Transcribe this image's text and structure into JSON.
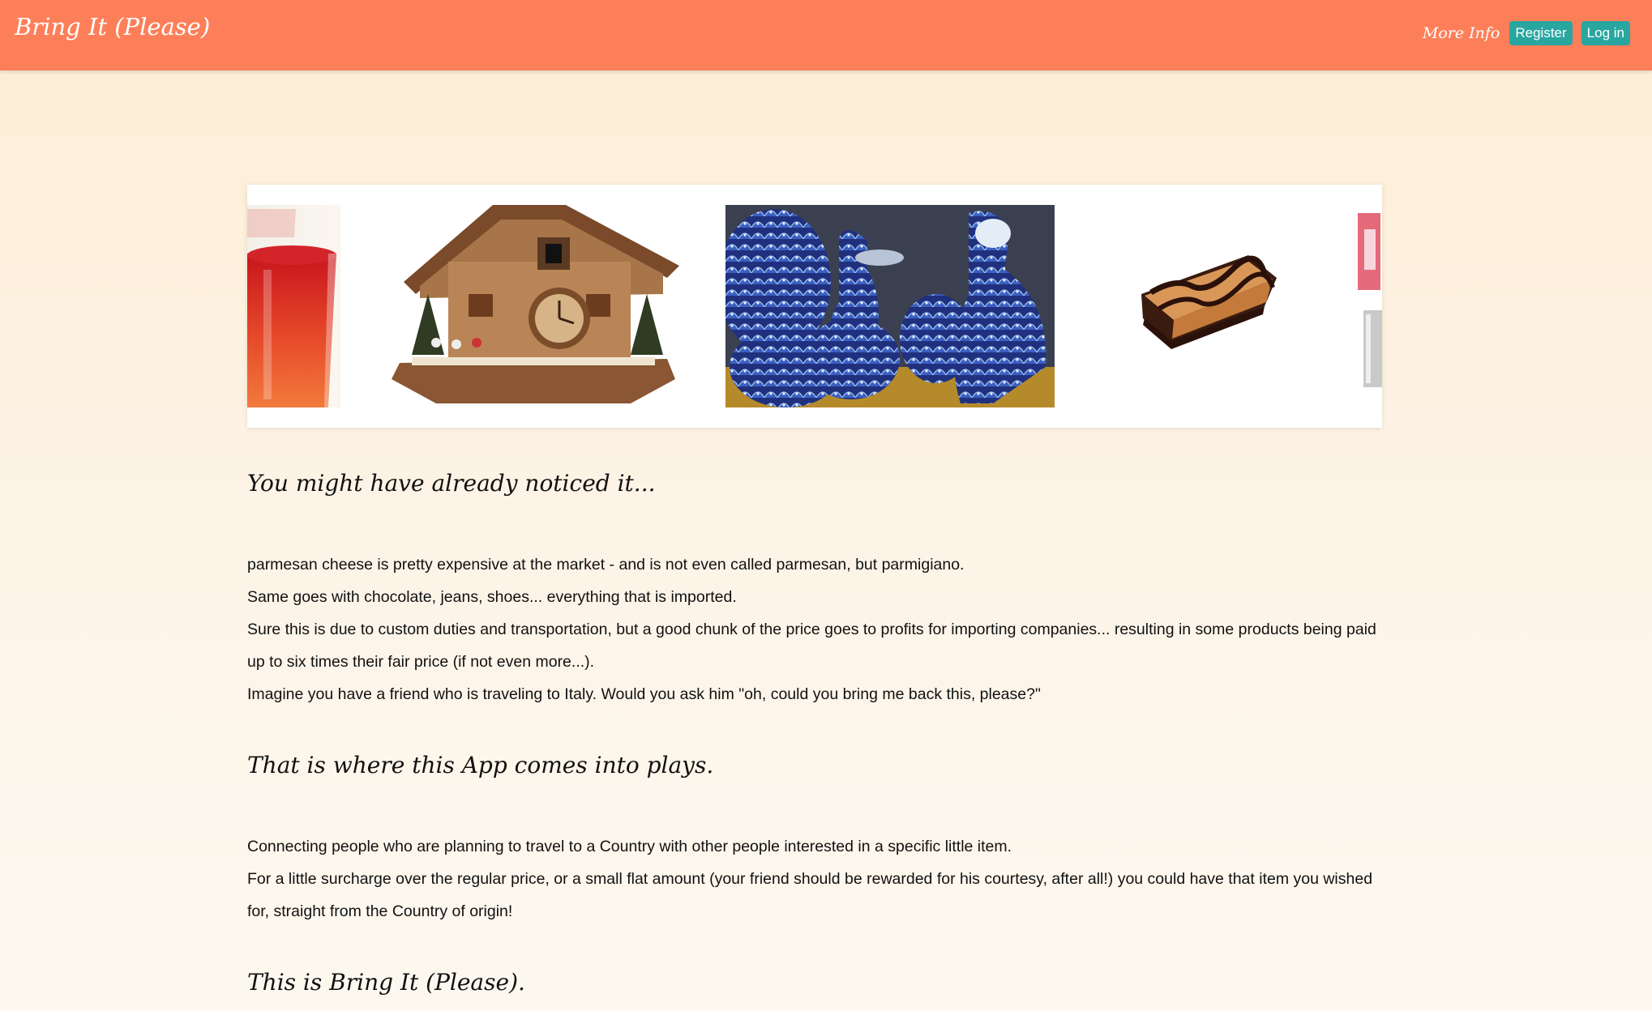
{
  "header": {
    "brand": "Bring It (Please)",
    "more_info": "More Info",
    "register_label": "Register",
    "login_label": "Log in",
    "bg_color": "#fd7f59",
    "button_color": "#2aa6a0"
  },
  "carousel": {
    "slides": [
      "red-drink-glass",
      "cuckoo-clock",
      "persian-enamel-vases",
      "chocolate-cake-bar",
      "partial-product"
    ]
  },
  "sections": [
    {
      "heading": "You might have already noticed it...",
      "lines": [
        "parmesan cheese is pretty expensive at the market - and is not even called parmesan, but parmigiano.",
        "Same goes with chocolate, jeans, shoes... everything that is imported.",
        "Sure this is due to custom duties and transportation, but a good chunk of the price goes to profits for importing companies... resulting in some products being paid",
        "up to six times their fair price (if not even more...).",
        "Imagine you have a friend who is traveling to Italy. Would you ask him \"oh, could you bring me back this, please?\""
      ]
    },
    {
      "heading": "That is where this App comes into plays.",
      "lines": [
        "Connecting people who are planning to travel to a Country with other people interested in a specific little item.",
        "For a little surcharge over the regular price, or a small flat amount (your friend should be rewarded for his courtesy, after all!) you could have that item you wished",
        "for, straight from the Country of origin!"
      ]
    },
    {
      "heading": "This is Bring It (Please).",
      "lines": []
    }
  ]
}
